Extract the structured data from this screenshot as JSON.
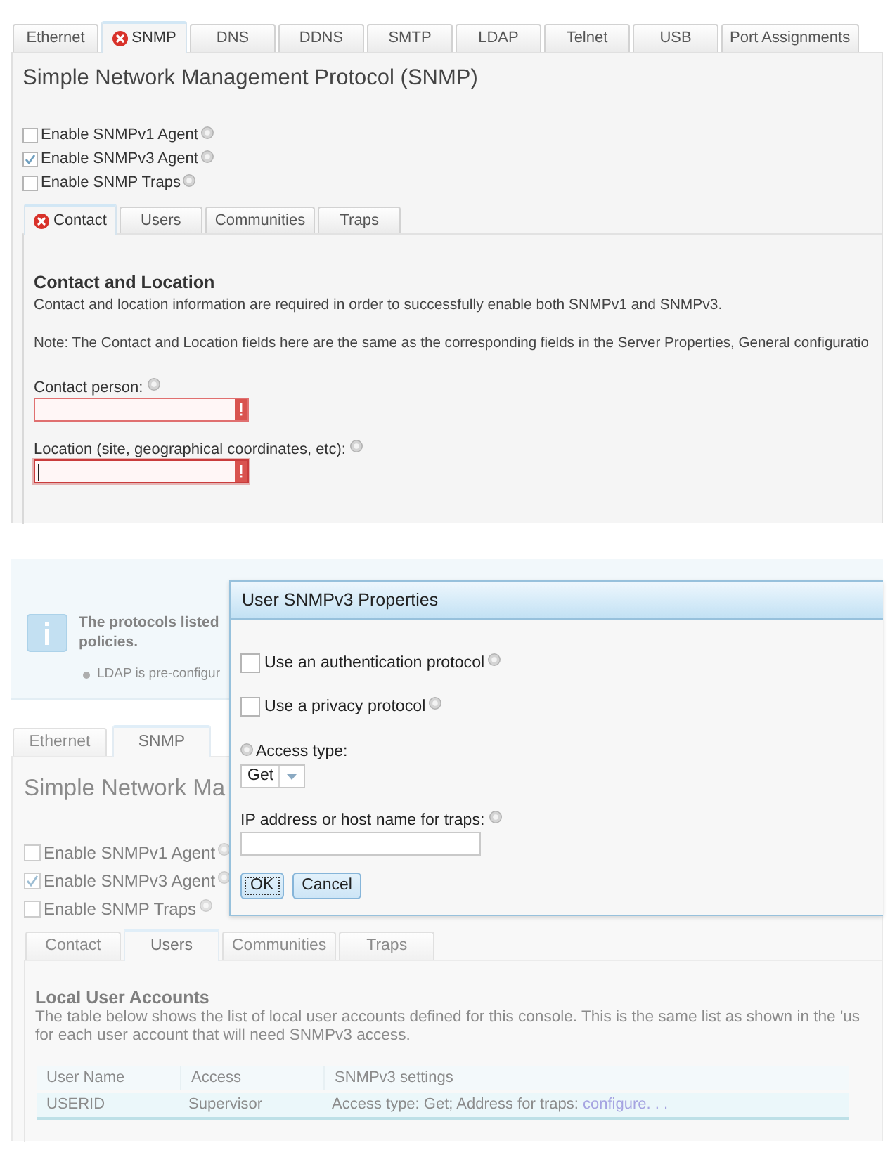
{
  "upper_screen": {
    "tabs": [
      {
        "label": "Ethernet",
        "selected": false,
        "error": false
      },
      {
        "label": "SNMP",
        "selected": true,
        "error": true
      },
      {
        "label": "DNS",
        "selected": false,
        "error": false
      },
      {
        "label": "DDNS",
        "selected": false,
        "error": false
      },
      {
        "label": "SMTP",
        "selected": false,
        "error": false
      },
      {
        "label": "LDAP",
        "selected": false,
        "error": false
      },
      {
        "label": "Telnet",
        "selected": false,
        "error": false
      },
      {
        "label": "USB",
        "selected": false,
        "error": false
      },
      {
        "label": "Port Assignments",
        "selected": false,
        "error": false
      }
    ],
    "title": "Simple Network Management Protocol (SNMP)",
    "options": [
      {
        "label": "Enable SNMPv1 Agent",
        "checked": false
      },
      {
        "label": "Enable SNMPv3 Agent",
        "checked": true
      },
      {
        "label": "Enable SNMP Traps",
        "checked": false
      }
    ],
    "subtabs": [
      {
        "label": "Contact",
        "selected": true,
        "error": true
      },
      {
        "label": "Users",
        "selected": false,
        "error": false
      },
      {
        "label": "Communities",
        "selected": false,
        "error": false
      },
      {
        "label": "Traps",
        "selected": false,
        "error": false
      }
    ],
    "contact_section": {
      "heading": "Contact and Location",
      "description": "Contact and location information are required in order to successfully enable both SNMPv1 and SNMPv3.",
      "note": "Note: The Contact and Location fields here are the same as the corresponding fields in the Server Properties, General configuratio",
      "fields": [
        {
          "label": "Contact person:",
          "invalid": true,
          "focused": false
        },
        {
          "label": "Location (site, geographical coordinates, etc):",
          "invalid": true,
          "focused": true
        }
      ]
    }
  },
  "lower_screen": {
    "info_box": {
      "lines": [
        "The protocols listed",
        "policies."
      ],
      "bullets": [
        "LDAP is pre-configur"
      ]
    },
    "tabs": [
      {
        "label": "Ethernet",
        "selected": false,
        "error": false
      },
      {
        "label": "SNMP",
        "selected": true,
        "error": false
      }
    ],
    "title": "Simple Network Ma",
    "options": [
      {
        "label": "Enable SNMPv1 Agent",
        "checked": false
      },
      {
        "label": "Enable SNMPv3 Agent",
        "checked": true
      },
      {
        "label": "Enable SNMP Traps",
        "checked": false
      }
    ],
    "subtabs": [
      {
        "label": "Contact",
        "selected": false,
        "error": false
      },
      {
        "label": "Users",
        "selected": true,
        "error": false
      },
      {
        "label": "Communities",
        "selected": false,
        "error": false
      },
      {
        "label": "Traps",
        "selected": false,
        "error": false
      }
    ],
    "users_section": {
      "heading": "Local User Accounts",
      "description": [
        "The table below shows the list of local user accounts defined for this console. This is the same list as shown in the 'us",
        "for each user account that will need SNMPv3 access."
      ],
      "table": {
        "columns": [
          "User Name",
          "Access",
          "SNMPv3 settings"
        ],
        "rows": [
          {
            "user_name": "USERID",
            "access": "Supervisor",
            "settings": "Access type: Get; Address for traps:",
            "settings_link": "configure. . .",
            "selected": true
          }
        ]
      }
    },
    "dialog": {
      "title": "User SNMPv3 Properties",
      "options": [
        {
          "label": "Use an authentication protocol",
          "checked": false
        },
        {
          "label": "Use a privacy protocol",
          "checked": false
        }
      ],
      "access_type": {
        "label": "Access type:",
        "value": "Get"
      },
      "trap_address": {
        "label": "IP address or host name for traps:"
      },
      "buttons": [
        {
          "label": "OK",
          "focused": true
        },
        {
          "label": "Cancel",
          "focused": false
        }
      ]
    }
  }
}
